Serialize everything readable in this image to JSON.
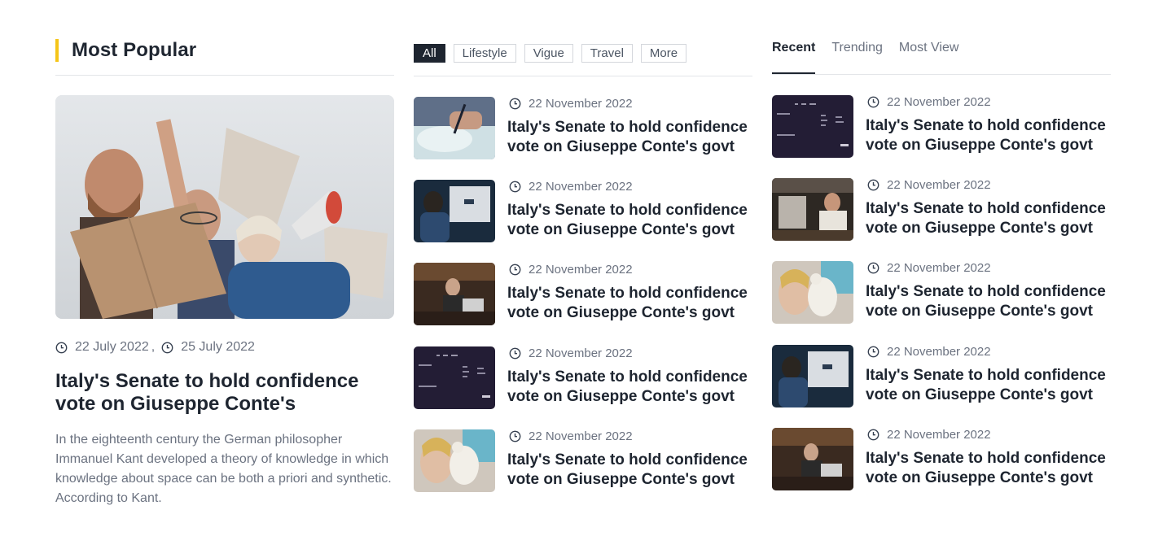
{
  "popular": {
    "title": "Most Popular",
    "hero": {
      "date1": "22 July 2022",
      "date_separator": ",",
      "date2": "25 July 2022",
      "title": "Italy's Senate to hold confidence vote on Giuseppe Conte's",
      "description": "In the eighteenth century the German philosopher Immanuel Kant developed a theory of knowledge in which knowledge about space can be both a priori and synthetic. According to Kant."
    }
  },
  "filters": {
    "items": [
      "All",
      "Lifestyle",
      "Vigue",
      "Travel",
      "More"
    ],
    "active": "All",
    "articles": [
      {
        "date": "22 November 2022",
        "title": "Italy's Senate to hold confidence vote on Giuseppe Conte's govt",
        "thumb": "signing-document"
      },
      {
        "date": "22 November 2022",
        "title": "Italy's Senate to hold confidence vote on Giuseppe Conte's govt",
        "thumb": "man-at-monitor"
      },
      {
        "date": "22 November 2022",
        "title": "Italy's Senate to hold confidence vote on Giuseppe Conte's govt",
        "thumb": "woman-laptop-cafe"
      },
      {
        "date": "22 November 2022",
        "title": "Italy's Senate to hold confidence vote on Giuseppe Conte's govt",
        "thumb": "dark-screen"
      },
      {
        "date": "22 November 2022",
        "title": "Italy's Senate to hold confidence vote on Giuseppe Conte's govt",
        "thumb": "woman-teddy-bear"
      }
    ]
  },
  "tabs": {
    "items": [
      "Recent",
      "Trending",
      "Most View"
    ],
    "active": "Recent",
    "articles": [
      {
        "date": "22 November 2022",
        "title": "Italy's Senate to hold confidence vote on Giuseppe Conte's govt",
        "thumb": "dark-screen"
      },
      {
        "date": "22 November 2022",
        "title": "Italy's Senate to hold confidence vote on Giuseppe Conte's govt",
        "thumb": "barista-coffee"
      },
      {
        "date": "22 November 2022",
        "title": "Italy's Senate to hold confidence vote on Giuseppe Conte's govt",
        "thumb": "woman-teddy-bear"
      },
      {
        "date": "22 November 2022",
        "title": "Italy's Senate to hold confidence vote on Giuseppe Conte's govt",
        "thumb": "man-at-monitor"
      },
      {
        "date": "22 November 2022",
        "title": "Italy's Senate to hold confidence vote on Giuseppe Conte's govt",
        "thumb": "woman-laptop-cafe"
      }
    ]
  },
  "colors": {
    "accent": "#f5c518",
    "dark": "#1e2530",
    "muted": "#6b7280",
    "rule": "#e3e5e8"
  },
  "icons": {
    "date": "clock-icon"
  }
}
